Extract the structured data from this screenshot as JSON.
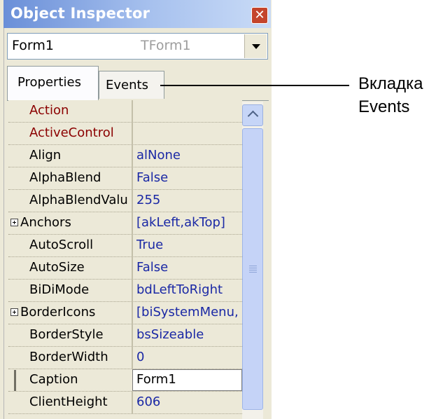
{
  "window": {
    "title": "Object Inspector"
  },
  "combo": {
    "object_name": "Form1",
    "object_type": "TForm1"
  },
  "tabs": [
    {
      "label": "Properties"
    },
    {
      "label": "Events"
    }
  ],
  "properties": [
    {
      "name": "Action",
      "value": "",
      "red": true
    },
    {
      "name": "ActiveControl",
      "value": "",
      "red": true
    },
    {
      "name": "Align",
      "value": "alNone"
    },
    {
      "name": "AlphaBlend",
      "value": "False"
    },
    {
      "name": "AlphaBlendValu",
      "value": "255"
    },
    {
      "name": "Anchors",
      "value": "[akLeft,akTop]",
      "expandable": true
    },
    {
      "name": "AutoScroll",
      "value": "True"
    },
    {
      "name": "AutoSize",
      "value": "False"
    },
    {
      "name": "BiDiMode",
      "value": "bdLeftToRight"
    },
    {
      "name": "BorderIcons",
      "value": "[biSystemMenu,",
      "expandable": true
    },
    {
      "name": "BorderStyle",
      "value": "bsSizeable"
    },
    {
      "name": "BorderWidth",
      "value": "0"
    },
    {
      "name": "Caption",
      "value": "Form1",
      "selected": true
    },
    {
      "name": "ClientHeight",
      "value": "606"
    }
  ],
  "annotation": {
    "line1": "Вкладка",
    "line2": "Events"
  },
  "colors": {
    "title_gradient_start": "#6a8fd8",
    "property_value": "#1a28a5",
    "event_property": "#8b0000"
  },
  "icons": [
    "close-icon",
    "dropdown-arrow-icon",
    "scroll-up-icon",
    "expand-plus-icon"
  ]
}
